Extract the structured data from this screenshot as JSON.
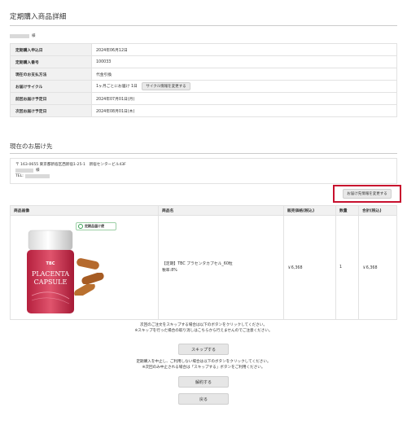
{
  "page": {
    "title": "定期購入商品詳細"
  },
  "customer": {
    "honorific": "様"
  },
  "info": {
    "rows": [
      {
        "label": "定期購入申込日",
        "value": "2024年06月12日"
      },
      {
        "label": "定期購入番号",
        "value": "100033"
      },
      {
        "label": "現在のお支払方法",
        "value": "代金引換"
      },
      {
        "label": "お届けサイクル",
        "value": "1ヶ月ごとにお届け 1日",
        "button": "サイクル情報を変更する"
      },
      {
        "label": "前回お届け予定日",
        "value": "2024年07月01日(月)"
      },
      {
        "label": "次回お届け予定日",
        "value": "2024年08月01日(木)"
      }
    ]
  },
  "delivery": {
    "section_title": "現在のお届け先",
    "address_line": "〒 163-0655 東京都新宿区西新宿1-25-1　新宿センタービル43F",
    "honorific": "様",
    "tel_label": "TEL:",
    "change_button": "お届け先情報を変更する"
  },
  "products": {
    "headers": [
      "商品画像",
      "商品名",
      "販売価格(税込)",
      "数量",
      "合計(税込)"
    ],
    "badge": "定期品届け便",
    "bottle_brand": "TBC",
    "bottle_text_1": "PLACENTA",
    "bottle_text_2": "CAPSULE",
    "name_line1": "【定期】TBC プラセンタカプセル_60粒",
    "name_line2": "税率:8%",
    "price": "￥6,368",
    "qty": "1",
    "total": "￥6,368"
  },
  "actions": {
    "skip_note_1": "次回のご注文をスキップする場合は以下のボタンをクリックしてください。",
    "skip_note_2": "※スキップを行った場合の取り消しはこちらから行えませんのでご注意ください。",
    "skip_button": "スキップする",
    "cancel_note_1": "定期購入を中止し、ご利用しない場合は以下のボタンをクリックしてください。",
    "cancel_note_2": "※次回のみ中止される場合は「スキップする」ボタンをご利用ください。",
    "cancel_button": "解約する",
    "back_button": "戻る"
  }
}
